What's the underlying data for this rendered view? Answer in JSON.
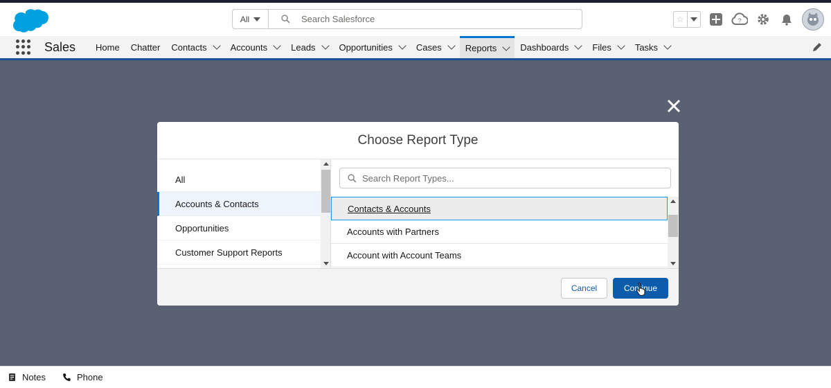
{
  "app": {
    "name": "Sales"
  },
  "global_search": {
    "scope": "All",
    "placeholder": "Search Salesforce"
  },
  "nav": {
    "items": [
      {
        "label": "Home",
        "dropdown": false
      },
      {
        "label": "Chatter",
        "dropdown": false
      },
      {
        "label": "Contacts",
        "dropdown": true
      },
      {
        "label": "Accounts",
        "dropdown": true
      },
      {
        "label": "Leads",
        "dropdown": true
      },
      {
        "label": "Opportunities",
        "dropdown": true
      },
      {
        "label": "Cases",
        "dropdown": true
      },
      {
        "label": "Reports",
        "dropdown": true,
        "active": true
      },
      {
        "label": "Dashboards",
        "dropdown": true
      },
      {
        "label": "Files",
        "dropdown": true
      },
      {
        "label": "Tasks",
        "dropdown": true
      }
    ]
  },
  "modal": {
    "title": "Choose Report Type",
    "categories": [
      "All",
      "Accounts & Contacts",
      "Opportunities",
      "Customer Support Reports"
    ],
    "selected_category": "Accounts & Contacts",
    "search_placeholder": "Search Report Types...",
    "report_types": [
      "Contacts & Accounts",
      "Accounts with Partners",
      "Account with Account Teams"
    ],
    "selected_report_type": "Contacts & Accounts",
    "cancel_label": "Cancel",
    "continue_label": "Continue"
  },
  "utility_bar": {
    "notes_label": "Notes",
    "phone_label": "Phone"
  },
  "colors": {
    "brand": "#0b5cab",
    "accent": "#0176d3",
    "overlay": "#5a6172"
  }
}
